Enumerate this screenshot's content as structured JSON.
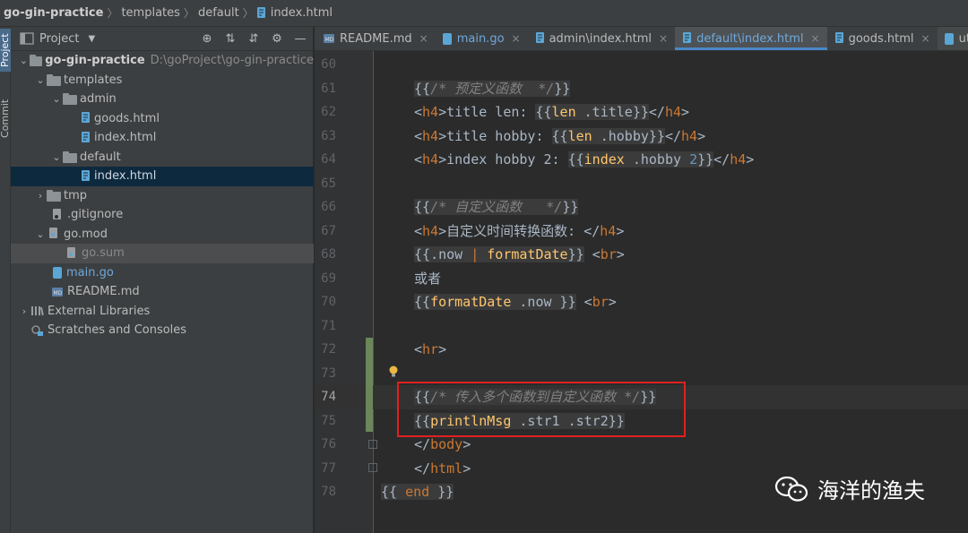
{
  "breadcrumb": {
    "items": [
      "go-gin-practice",
      "templates",
      "default",
      "index.html"
    ]
  },
  "toolstrip": {
    "project_label": "Project",
    "commit_label": "Commit"
  },
  "project_panel": {
    "title": "Project",
    "tree": [
      {
        "label": "go-gin-practice",
        "hint": "D:\\goProject\\go-gin-practice",
        "type": "folder",
        "level": 0,
        "expanded": true
      },
      {
        "label": "templates",
        "type": "folder",
        "level": 1,
        "expanded": true
      },
      {
        "label": "admin",
        "type": "folder",
        "level": 2,
        "expanded": true
      },
      {
        "label": "goods.html",
        "type": "html",
        "level": 3
      },
      {
        "label": "index.html",
        "type": "html",
        "level": 3
      },
      {
        "label": "default",
        "type": "folder",
        "level": 2,
        "expanded": true
      },
      {
        "label": "index.html",
        "type": "html",
        "level": 3,
        "selected": true
      },
      {
        "label": "tmp",
        "type": "folder",
        "level": 1,
        "expanded": false
      },
      {
        "label": ".gitignore",
        "type": "file",
        "level": 1
      },
      {
        "label": "go.mod",
        "type": "gomod",
        "level": 1,
        "expanded": true
      },
      {
        "label": "go.sum",
        "type": "gosum",
        "level": 2,
        "hilite": true
      },
      {
        "label": "main.go",
        "type": "go",
        "level": 1
      },
      {
        "label": "README.md",
        "type": "md",
        "level": 1
      },
      {
        "label": "External Libraries",
        "type": "lib",
        "level": 0,
        "expanded": false
      },
      {
        "label": "Scratches and Consoles",
        "type": "scratch",
        "level": 0
      }
    ]
  },
  "tabs": [
    {
      "label": "README.md",
      "active": false
    },
    {
      "label": "main.go",
      "active": false
    },
    {
      "label": "admin\\index.html",
      "active": false
    },
    {
      "label": "default\\index.html",
      "active": true
    },
    {
      "label": "goods.html",
      "active": false
    },
    {
      "label": "utils.go",
      "active": false
    }
  ],
  "editor": {
    "current_line": 74,
    "lines": [
      {
        "num": "60"
      },
      {
        "num": "61"
      },
      {
        "num": "62"
      },
      {
        "num": "63"
      },
      {
        "num": "64"
      },
      {
        "num": "65"
      },
      {
        "num": "66"
      },
      {
        "num": "67"
      },
      {
        "num": "68"
      },
      {
        "num": "69"
      },
      {
        "num": "70"
      },
      {
        "num": "71"
      },
      {
        "num": "72"
      },
      {
        "num": "73"
      },
      {
        "num": "74"
      },
      {
        "num": "75"
      },
      {
        "num": "76"
      },
      {
        "num": "77"
      },
      {
        "num": "78"
      }
    ],
    "code": {
      "l61_cmt": "/* 预定义函数  */",
      "l62_text": "title len: ",
      "l62_fn": "len",
      "l62_var": ".title",
      "l63_text": "title hobby: ",
      "l63_fn": "len",
      "l63_var": ".hobby",
      "l64_text": "index hobby 2: ",
      "l64_fn": "index",
      "l64_var": ".hobby",
      "l64_num": "2",
      "l66_cmt": "/* 自定义函数   */",
      "l67_text": "自定义时间转换函数: ",
      "l68_var": ".now",
      "l68_fn": "formatDate",
      "l69_text": "或者",
      "l70_fn": "formatDate",
      "l70_var": ".now",
      "l74_cmt": "/* 传入多个函数到自定义函数 */",
      "l75_fn": "printlnMsg",
      "l75_var1": ".str1",
      "l75_var2": ".str2",
      "l78_kw": "end",
      "tag_h4": "h4",
      "tag_br": "br",
      "tag_hr": "hr",
      "tag_body": "body",
      "tag_html": "html"
    }
  },
  "watermark": {
    "text": "海洋的渔夫"
  }
}
